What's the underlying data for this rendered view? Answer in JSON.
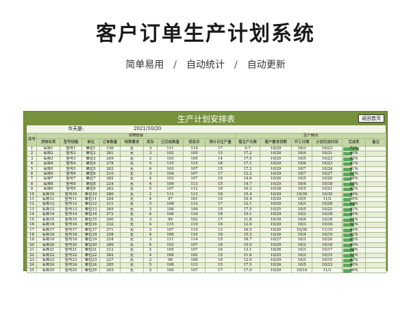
{
  "banner": {
    "title": "客户订单生产计划系统",
    "features": [
      "简单易用",
      "自动统计",
      "自动更新"
    ],
    "separator": "/"
  },
  "sheet": {
    "title": "生产计划安排表",
    "back_button": "返回首页",
    "today_label": "今天是:",
    "today_value": "2021/10/20",
    "group_goods": "货物信息",
    "group_production": "生产情况",
    "col_index": "序号",
    "columns": [
      "货物名称",
      "型号规格",
      "单位",
      "订单数量",
      "特殊要求",
      "库存",
      "已完成数量",
      "现库存",
      "预计日生产量",
      "需生产天数",
      "客户要求货期",
      "开工日期",
      "计划完成时间",
      "完成率",
      "备注"
    ]
  },
  "colors": {
    "sheet_bg": "#76923c",
    "header_bg": "#c6d7a7",
    "bar": "#5aa85a"
  },
  "rows": [
    {
      "i": "1",
      "name": "名称1",
      "model": "型号1",
      "unit": "单位1",
      "qty": "136",
      "req": "无",
      "stock": "3",
      "done": "111",
      "cur": "114",
      "daily": "17",
      "days": "9.7",
      "due": "10/29",
      "start": "10/3",
      "plan": "10/23",
      "rate": "73%",
      "rate_v": 0.73
    },
    {
      "i": "2",
      "name": "名称2",
      "model": "型号2",
      "unit": "单位2",
      "qty": "261",
      "req": "无",
      "stock": "3",
      "done": "102",
      "cur": "105",
      "daily": "15",
      "days": "17.2",
      "due": "10/30",
      "start": "10/4",
      "plan": "10/31",
      "rate": "40%",
      "rate_v": 0.4
    },
    {
      "i": "3",
      "name": "名称3",
      "model": "型号3",
      "unit": "单位3",
      "qty": "249",
      "req": "无",
      "stock": "2",
      "done": "103",
      "cur": "105",
      "daily": "14",
      "days": "17.5",
      "due": "10/29",
      "start": "10/5",
      "plan": "10/23",
      "rate": "42%",
      "rate_v": 0.42
    },
    {
      "i": "4",
      "name": "名称4",
      "model": "型号4",
      "unit": "单位4",
      "qty": "278",
      "req": "无",
      "stock": "5",
      "done": "110",
      "cur": "115",
      "daily": "16",
      "days": "17.1",
      "due": "10/29",
      "start": "10/6",
      "plan": "10/23",
      "rate": "41%",
      "rate_v": 0.41
    },
    {
      "i": "5",
      "name": "名称5",
      "model": "型号5",
      "unit": "单位5",
      "qty": "262",
      "req": "无",
      "stock": "4",
      "done": "103",
      "cur": "107",
      "daily": "15",
      "days": "17.2",
      "due": "10/29",
      "start": "10/7",
      "plan": "10/24",
      "rate": "41%",
      "rate_v": 0.41
    },
    {
      "i": "6",
      "name": "名称6",
      "model": "型号6",
      "unit": "单位6",
      "qty": "210",
      "req": "无",
      "stock": "3",
      "done": "104",
      "cur": "107",
      "daily": "17",
      "days": "12.2",
      "due": "10/29",
      "start": "10/7",
      "plan": "10/27",
      "rate": "51%",
      "rate_v": 0.51
    },
    {
      "i": "7",
      "name": "名称7",
      "model": "型号7",
      "unit": "单位7",
      "qty": "282",
      "req": "无",
      "stock": "4",
      "done": "103",
      "cur": "107",
      "daily": "19",
      "days": "14.6",
      "due": "10/26",
      "start": "10/5",
      "plan": "10/20",
      "rate": "38%",
      "rate_v": 0.38
    },
    {
      "i": "8",
      "name": "名称8",
      "model": "型号8",
      "unit": "单位8",
      "qty": "224",
      "req": "无",
      "stock": "4",
      "done": "109",
      "cur": "113",
      "daily": "15",
      "days": "14.7",
      "due": "10/29",
      "start": "10/4",
      "plan": "10/18",
      "rate": "50%",
      "rate_v": 0.5
    },
    {
      "i": "9",
      "name": "名称9",
      "model": "型号9",
      "unit": "单位9",
      "qty": "262",
      "req": "无",
      "stock": "5",
      "done": "107",
      "cur": "112",
      "daily": "16",
      "days": "16.3",
      "due": "10/28",
      "start": "10/5",
      "plan": "10/21",
      "rate": "42%",
      "rate_v": 0.42
    },
    {
      "i": "10",
      "name": "名称10",
      "model": "型号10",
      "unit": "单位10",
      "qty": "280",
      "req": "无",
      "stock": "2",
      "done": "111",
      "cur": "113",
      "daily": "18",
      "days": "15.4",
      "due": "10/29",
      "start": "10/30",
      "plan": "10/30",
      "rate": "40%",
      "rate_v": 0.4
    },
    {
      "i": "11",
      "name": "名称11",
      "model": "型号11",
      "unit": "单位11",
      "qty": "294",
      "req": "无",
      "stock": "4",
      "done": "97",
      "cur": "101",
      "daily": "15",
      "days": "19.4",
      "due": "10/29",
      "start": "10/5",
      "plan": "11/2",
      "rate": "35%",
      "rate_v": 0.35
    },
    {
      "i": "12",
      "name": "名称12",
      "model": "型号12",
      "unit": "单位12",
      "qty": "211",
      "req": "无",
      "stock": "5",
      "done": "108",
      "cur": "113",
      "daily": "17",
      "days": "12.1",
      "due": "10/29",
      "start": "10/3",
      "plan": "10/28",
      "rate": "54%",
      "rate_v": 0.54
    },
    {
      "i": "13",
      "name": "名称13",
      "model": "型号13",
      "unit": "单位13",
      "qty": "265",
      "req": "无",
      "stock": "3",
      "done": "106",
      "cur": "109",
      "daily": "15",
      "days": "17.5",
      "due": "10/25",
      "start": "10/5",
      "plan": "10/22",
      "rate": "41%",
      "rate_v": 0.41
    },
    {
      "i": "14",
      "name": "名称14",
      "model": "型号14",
      "unit": "单位14",
      "qty": "272",
      "req": "无",
      "stock": "4",
      "done": "106",
      "cur": "110",
      "daily": "18",
      "days": "15.1",
      "due": "10/29",
      "start": "10/3",
      "plan": "10/18",
      "rate": "40%",
      "rate_v": 0.4
    },
    {
      "i": "15",
      "name": "名称15",
      "model": "型号15",
      "unit": "单位15",
      "qty": "200",
      "req": "无",
      "stock": "3",
      "done": "99",
      "cur": "102",
      "daily": "17",
      "days": "11.8",
      "due": "10/30",
      "start": "10/4",
      "plan": "10/16",
      "rate": "51%",
      "rate_v": 0.51
    },
    {
      "i": "16",
      "name": "名称16",
      "model": "型号16",
      "unit": "单位16",
      "qty": "232",
      "req": "无",
      "stock": "4",
      "done": "115",
      "cur": "119",
      "daily": "18",
      "days": "12.9",
      "due": "10/29",
      "start": "10/3",
      "plan": "10/16",
      "rate": "51%",
      "rate_v": 0.51
    },
    {
      "i": "17",
      "name": "名称17",
      "model": "型号17",
      "unit": "单位17",
      "qty": "271",
      "req": "无",
      "stock": "3",
      "done": "107",
      "cur": "110",
      "daily": "13",
      "days": "16.5",
      "due": "10/26",
      "start": "10/30",
      "plan": "11/15",
      "rate": "40%",
      "rate_v": 0.4
    },
    {
      "i": "18",
      "name": "名称18",
      "model": "型号18",
      "unit": "单位18",
      "qty": "258",
      "req": "无",
      "stock": "4",
      "done": "106",
      "cur": "110",
      "daily": "18",
      "days": "15.3",
      "due": "10/30",
      "start": "10/4",
      "plan": "10/19",
      "rate": "42%",
      "rate_v": 0.42
    },
    {
      "i": "19",
      "name": "名称19",
      "model": "型号19",
      "unit": "单位19",
      "qty": "254",
      "req": "无",
      "stock": "3",
      "done": "111",
      "cur": "114",
      "daily": "15",
      "days": "16.7",
      "due": "10/27",
      "start": "10/3",
      "plan": "10/20",
      "rate": "45%",
      "rate_v": 0.45
    },
    {
      "i": "20",
      "name": "名称20",
      "model": "型号20",
      "unit": "单位20",
      "qty": "266",
      "req": "无",
      "stock": "4",
      "done": "103",
      "cur": "107",
      "daily": "18",
      "days": "15.0",
      "due": "10/29",
      "start": "10/3",
      "plan": "10/18",
      "rate": "40%",
      "rate_v": 0.4
    },
    {
      "i": "21",
      "name": "名称21",
      "model": "型号21",
      "unit": "单位21",
      "qty": "212",
      "req": "无",
      "stock": "2",
      "done": "105",
      "cur": "107",
      "daily": "16",
      "days": "13.1",
      "due": "10/26",
      "start": "10/3",
      "plan": "10/17",
      "rate": "50%",
      "rate_v": 0.5
    },
    {
      "i": "22",
      "name": "名称22",
      "model": "型号22",
      "unit": "单位22",
      "qty": "282",
      "req": "无",
      "stock": "4",
      "done": "106",
      "cur": "102",
      "daily": "15",
      "days": "11.6",
      "due": "10/25",
      "start": "10/3",
      "plan": "10/15",
      "rate": "51%",
      "rate_v": 0.51
    },
    {
      "i": "23",
      "name": "名称23",
      "model": "型号23",
      "unit": "单位23",
      "qty": "227",
      "req": "无",
      "stock": "2",
      "done": "98",
      "cur": "100",
      "daily": "19",
      "days": "12.0",
      "due": "10/29",
      "start": "10/3",
      "plan": "10/15",
      "rate": "43%",
      "rate_v": 0.43
    },
    {
      "i": "24",
      "name": "名称24",
      "model": "型号24",
      "unit": "单位24",
      "qty": "285",
      "req": "无",
      "stock": "5",
      "done": "108",
      "cur": "113",
      "daily": "15",
      "days": "17.5",
      "due": "10/26",
      "start": "10/5",
      "plan": "10/23",
      "rate": "40%",
      "rate_v": 0.4
    },
    {
      "i": "25",
      "name": "名称25",
      "model": "型号25",
      "unit": "单位25",
      "qty": "293",
      "req": "无",
      "stock": "2",
      "done": "105",
      "cur": "107",
      "daily": "17",
      "days": "17.0",
      "due": "10/29",
      "start": "10/14",
      "plan": "11/1",
      "rate": "36%",
      "rate_v": 0.36
    }
  ]
}
